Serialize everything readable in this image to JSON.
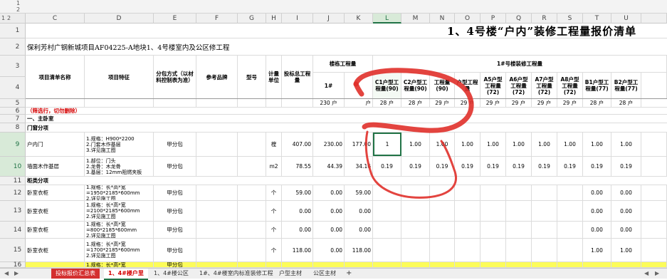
{
  "outline": {
    "levels": [
      "1",
      "2"
    ],
    "rows": [
      "1",
      "2"
    ]
  },
  "columns": [
    "C",
    "D",
    "E",
    "F",
    "G",
    "H",
    "I",
    "J",
    "K",
    "L",
    "M",
    "N",
    "O",
    "P",
    "Q",
    "R",
    "S",
    "T",
    "U"
  ],
  "row_numbers": [
    "1",
    "2",
    "3",
    "4",
    "5",
    "6",
    "7",
    "8",
    "9",
    "10",
    "11",
    "12",
    "13",
    "14",
    "15",
    "16"
  ],
  "sheet": {
    "title": "1、4号楼“户内”装修工程量报价清单",
    "project": "保利芳村广钢新城项目AF04225-A地块1、4号楼室内及公区修工程",
    "headers": {
      "item_name": "项目清单名称",
      "feature": "项目特征",
      "subcontract": "分包方式（以材料控制表为准）",
      "brand": "参考品牌",
      "model": "型号",
      "unit": "计量单位",
      "total_qty": "投标总工程量",
      "building_qty": "楼栋工程量",
      "b1_group": "1#号楼装修工程量",
      "h_1": "1#",
      "h_c1": "C1户型工程量(90)",
      "h_c2": "C2户型工程量(90)",
      "h_n": "工程量(90)",
      "h_o": "户型工程量",
      "h_a5": "A5户型工程量(72)",
      "h_a6": "A6户型工程量(72)",
      "h_a7": "A7户型工程量(72)",
      "h_a8": "A8户型工程量(72)",
      "h_b1": "B1户型工程量(77)",
      "h_b2": "B2户型工程量(77)"
    },
    "row5": [
      "230 户",
      "户",
      "28 户",
      "28 户",
      "29 户",
      "29 户",
      "29 户",
      "29 户",
      "29 户",
      "29 户",
      "28 户",
      "28 户"
    ],
    "filter_note": "（筛选行，切勿删除）",
    "section_master": "一、主卧室",
    "cat_doors": "门窗分项",
    "row9": {
      "name": "户内门",
      "feature": "1.规格：H900*2200\n2.门套木作基层\n3.详见施工图",
      "sub": "甲分包",
      "unit": "樘",
      "total": "407.00",
      "j": "230.00",
      "k": "177.00",
      "vals": [
        "1",
        "1.00",
        "1.00",
        "1.00",
        "1.00",
        "1.00",
        "1.00",
        "1.00",
        "1.00",
        "1.00"
      ]
    },
    "row10": {
      "name": "墙面木作基层",
      "feature": "1.部位：门头\n2.龙骨：木龙骨\n3.基层：12mm阻燃夹板",
      "sub": "甲分包",
      "unit": "m2",
      "total": "78.55",
      "j": "44.39",
      "k": "34.16",
      "vals": [
        "0.19",
        "0.19",
        "0.19",
        "0.19",
        "0.19",
        "0.19",
        "0.19",
        "0.19",
        "0.19",
        "0.19"
      ]
    },
    "cat_cabinet": "柜类分项",
    "row12": {
      "name": "卧室衣柜",
      "feature": "1.规格：长*高*宽\n=1950*2185*600mm\n2.详见施工图",
      "sub": "甲分包",
      "unit": "个",
      "total": "59.00",
      "j": "0.00",
      "k": "59.00",
      "vals": [
        "",
        "",
        "",
        "",
        "",
        "",
        "",
        "",
        "0.00",
        "0.00"
      ]
    },
    "row13": {
      "name": "卧室衣柜",
      "feature": "1.规格：长*高*宽\n=2100*2185*600mm\n2.详见施工图",
      "sub": "甲分包",
      "unit": "个",
      "total": "0.00",
      "j": "0.00",
      "k": "0.00",
      "vals": [
        "",
        "",
        "",
        "",
        "",
        "",
        "",
        "",
        "0.00",
        "0.00"
      ]
    },
    "row14": {
      "name": "卧室衣柜",
      "feature": "1.规格：长*高*宽\n=800*2185*600mm\n2.详见施工图",
      "sub": "甲分包",
      "unit": "个",
      "total": "0.00",
      "j": "0.00",
      "k": "0.00",
      "vals": [
        "",
        "",
        "",
        "",
        "",
        "",
        "",
        "",
        "0.00",
        "0.00"
      ]
    },
    "row15": {
      "name": "卧室衣柜",
      "feature": "1.规格：长*高*宽\n=1700*2185*600mm\n2.详见施工图",
      "sub": "甲分包",
      "unit": "个",
      "total": "118.00",
      "j": "0.00",
      "k": "118.00",
      "vals": [
        "",
        "",
        "",
        "",
        "",
        "",
        "",
        "",
        "1.00",
        "1.00"
      ]
    },
    "row16": {
      "feature": "1.规格：长*高*宽",
      "sub": "甲分包"
    }
  },
  "tabs": [
    "投标报价汇总表",
    "1、4#楼户里",
    "1、4#楼公区",
    "1#、4#楼室内标准装修工程",
    "户型主材",
    "公区主材"
  ],
  "add_tab": "+",
  "colors": {
    "accent": "#217346",
    "highlight": "#fcfc5a",
    "annotation": "#e0302a"
  }
}
